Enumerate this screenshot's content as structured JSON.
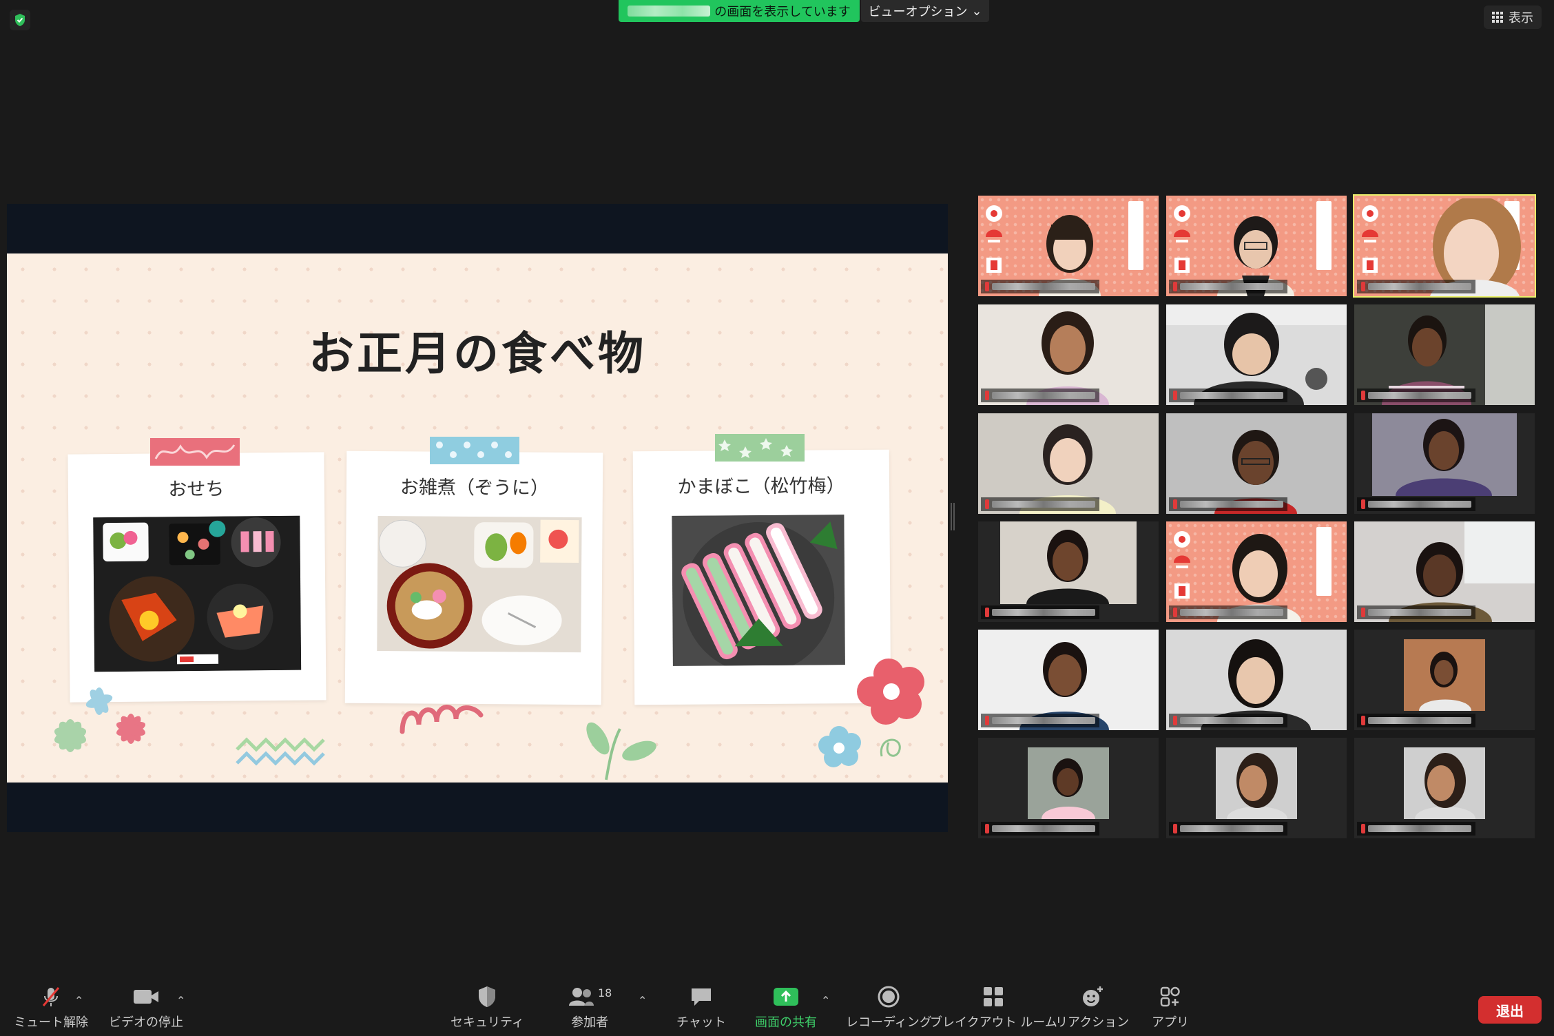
{
  "top": {
    "share_banner_suffix": "の画面を表示しています",
    "view_options": "ビューオプション",
    "view_button": "表示"
  },
  "slide": {
    "title": "お正月の食べ物",
    "cards": [
      {
        "label": "おせち"
      },
      {
        "label": "お雑煮（ぞうに）"
      },
      {
        "label": "かまぼこ（松竹梅）"
      }
    ]
  },
  "participants_count": "18",
  "toolbar": {
    "unmute": "ミュート解除",
    "stop_video": "ビデオの停止",
    "security": "セキュリティ",
    "participants": "参加者",
    "chat": "チャット",
    "share_screen": "画面の共有",
    "record": "レコーディング",
    "breakout": "ブレイクアウト ルーム",
    "reactions": "リアクション",
    "apps": "アプリ",
    "leave": "退出"
  },
  "colors": {
    "accent_green": "#21c55d",
    "leave_red": "#d32f2f",
    "active_speaker": "#e9f06b"
  }
}
